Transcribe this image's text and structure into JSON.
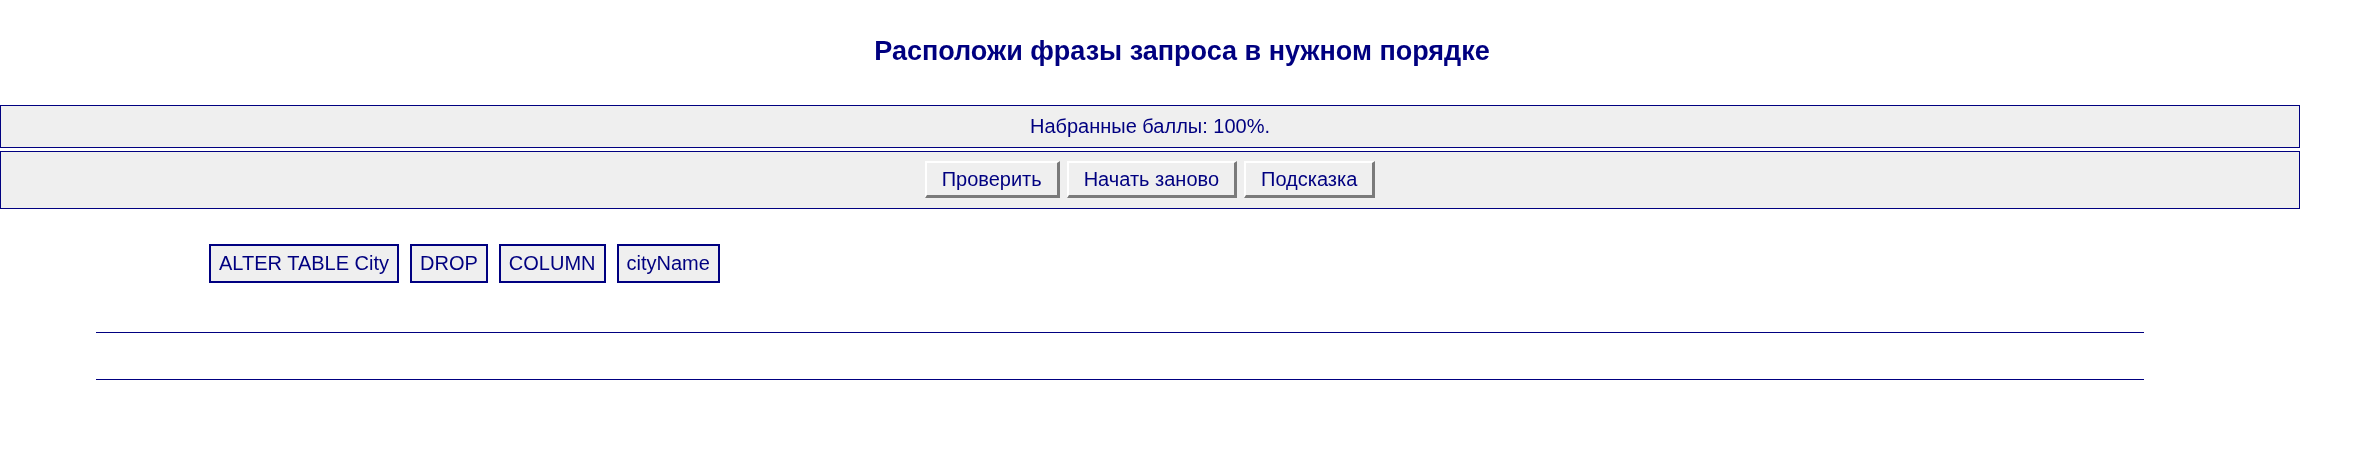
{
  "title": "Расположи фразы запроса в нужном порядке",
  "score": "Набранные баллы: 100%.",
  "buttons": [
    "Проверить",
    "Начать заново",
    "Подсказка"
  ],
  "phrases": [
    "ALTER TABLE City",
    "DROP",
    "COLUMN",
    "cityName"
  ]
}
